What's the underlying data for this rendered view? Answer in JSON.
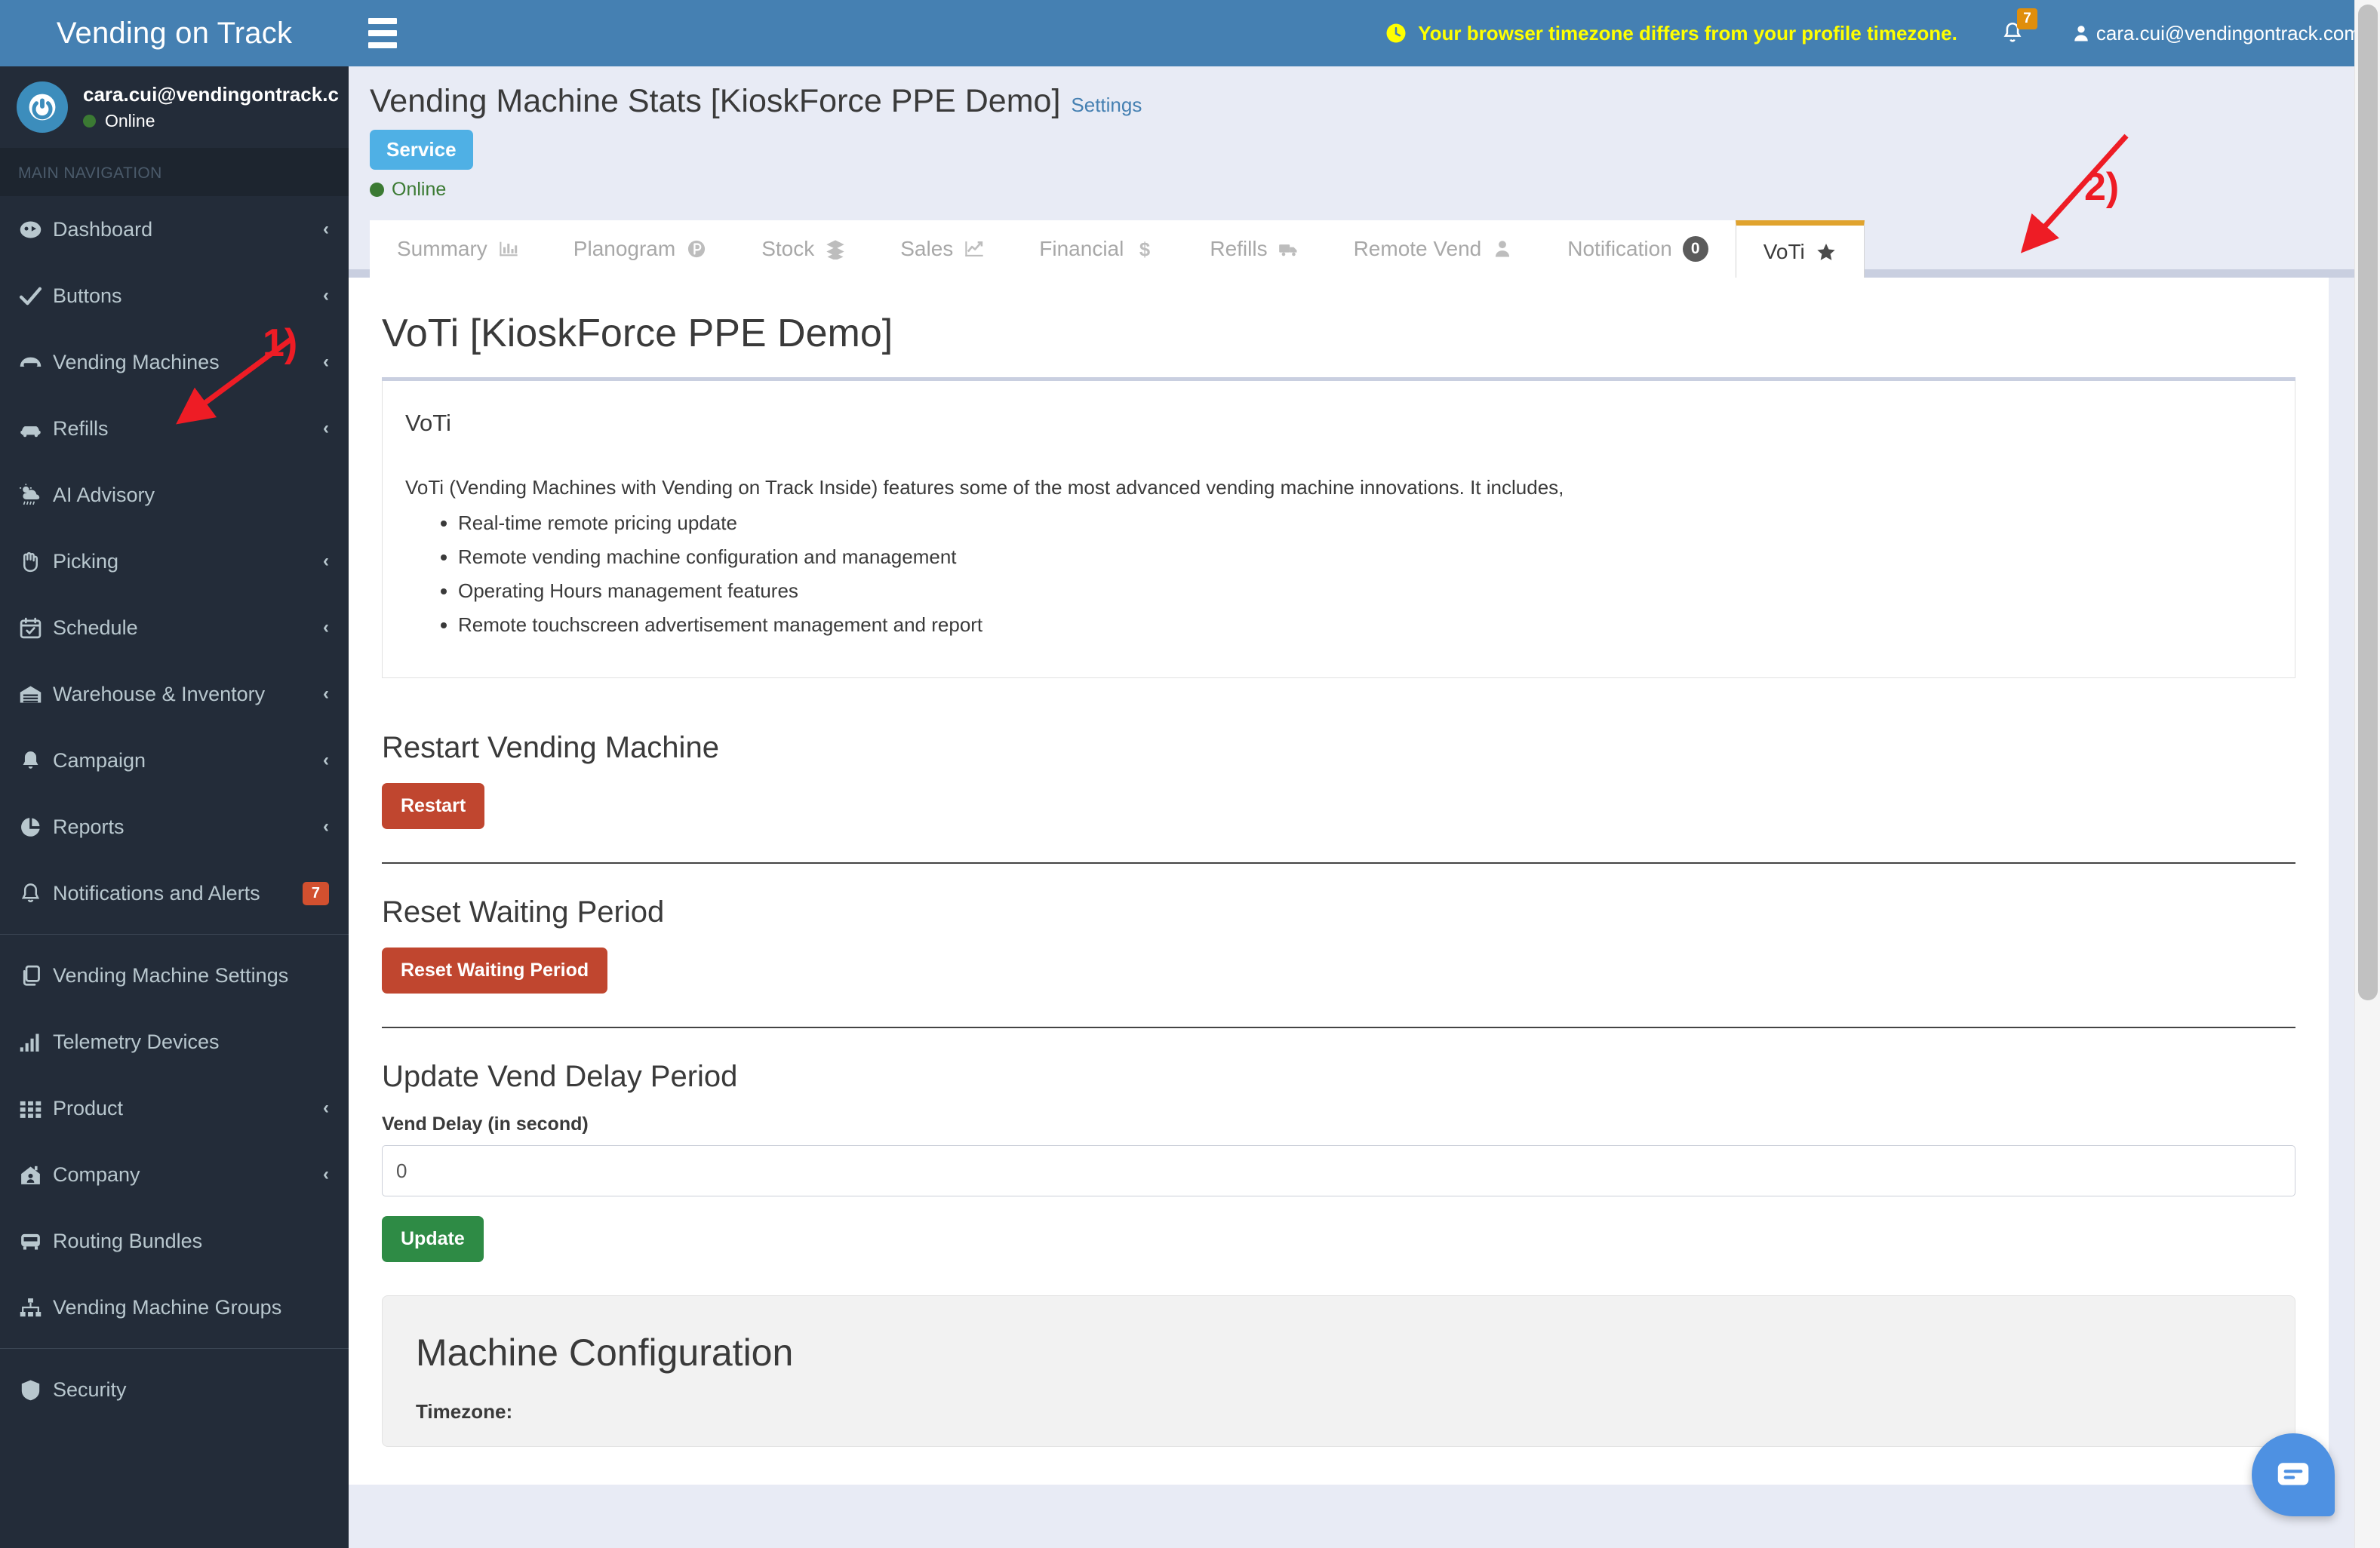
{
  "brand": {
    "title": "Vending on Track"
  },
  "user_panel": {
    "email": "cara.cui@vendingontrack.c",
    "status": "Online"
  },
  "sidebar": {
    "nav_header": "MAIN NAVIGATION",
    "items": [
      {
        "label": "Dashboard",
        "icon": "dashboard-icon",
        "chevron": "‹"
      },
      {
        "label": "Buttons",
        "icon": "check-icon",
        "chevron": "‹"
      },
      {
        "label": "Vending Machines",
        "icon": "vending-icon",
        "chevron": "‹"
      },
      {
        "label": "Refills",
        "icon": "car-icon",
        "chevron": "‹"
      },
      {
        "label": "AI Advisory",
        "icon": "weather-icon",
        "chevron": ""
      },
      {
        "label": "Picking",
        "icon": "hand-icon",
        "chevron": "‹"
      },
      {
        "label": "Schedule",
        "icon": "calendar-icon",
        "chevron": "‹"
      },
      {
        "label": "Warehouse & Inventory",
        "icon": "warehouse-icon",
        "chevron": "‹"
      },
      {
        "label": "Campaign",
        "icon": "bell-filled-icon",
        "chevron": "‹"
      },
      {
        "label": "Reports",
        "icon": "pie-chart-icon",
        "chevron": "‹"
      },
      {
        "label": "Notifications and Alerts",
        "icon": "bell-icon",
        "badge": "7"
      }
    ],
    "items2": [
      {
        "label": "Vending Machine Settings",
        "icon": "copy-icon",
        "chevron": ""
      },
      {
        "label": "Telemetry Devices",
        "icon": "signal-icon",
        "chevron": ""
      },
      {
        "label": "Product",
        "icon": "grid-icon",
        "chevron": "‹"
      },
      {
        "label": "Company",
        "icon": "building-icon",
        "chevron": "‹"
      },
      {
        "label": "Routing Bundles",
        "icon": "bus-icon",
        "chevron": ""
      },
      {
        "label": "Vending Machine Groups",
        "icon": "sitemap-icon",
        "chevron": ""
      }
    ],
    "items3": [
      {
        "label": "Security",
        "icon": "shield-icon",
        "chevron": ""
      }
    ]
  },
  "topbar": {
    "timezone_warning": "Your browser timezone differs from your profile timezone.",
    "notification_count": "7",
    "user_email": "cara.cui@vendingontrack.com"
  },
  "page": {
    "title": "Vending Machine Stats [KioskForce PPE Demo]",
    "settings_link": "Settings",
    "service_badge": "Service",
    "machine_status": "Online"
  },
  "tabs": [
    {
      "label": "Summary",
      "icon": "bar-chart-icon",
      "active": false
    },
    {
      "label": "Planogram",
      "icon": "p-circle-icon",
      "active": false
    },
    {
      "label": "Stock",
      "icon": "layers-icon",
      "active": false
    },
    {
      "label": "Sales",
      "icon": "line-chart-icon",
      "active": false
    },
    {
      "label": "Financial",
      "icon": "dollar-icon",
      "active": false
    },
    {
      "label": "Refills",
      "icon": "truck-icon",
      "active": false
    },
    {
      "label": "Remote Vend",
      "icon": "person-icon",
      "active": false
    },
    {
      "label": "Notification",
      "icon": "",
      "badge": "0",
      "active": false
    },
    {
      "label": "VoTi",
      "icon": "star-icon",
      "active": true
    }
  ],
  "main": {
    "heading": "VoTi [KioskForce PPE Demo]",
    "sub_heading": "VoTi",
    "paragraph": "VoTi (Vending Machines with Vending on Track Inside) features some of the most advanced vending machine innovations. It includes,",
    "features": [
      "Real-time remote pricing update",
      "Remote vending machine configuration and management",
      "Operating Hours management features",
      "Remote touchscreen advertisement management and report"
    ],
    "restart_section": {
      "heading": "Restart Vending Machine",
      "button": "Restart"
    },
    "reset_section": {
      "heading": "Reset Waiting Period",
      "button": "Reset Waiting Period"
    },
    "vend_delay_section": {
      "heading": "Update Vend Delay Period",
      "field_label": "Vend Delay (in second)",
      "field_value": "0",
      "button": "Update"
    },
    "config_section": {
      "heading": "Machine Configuration",
      "timezone_label": "Timezone:"
    }
  },
  "annotations": [
    {
      "label": "1)"
    },
    {
      "label": "2)"
    }
  ],
  "colors": {
    "header_blue": "#4580b2",
    "sidebar_dark": "#232c39",
    "accent_orange": "#e0a32e",
    "danger_red": "#c0462f",
    "success_green": "#2e8b45",
    "warning_yellow": "#ffff00",
    "annotation_red": "#ee1c25"
  }
}
